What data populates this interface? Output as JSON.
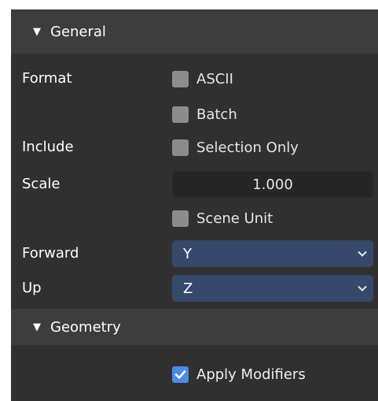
{
  "general": {
    "title": "General",
    "format_label": "Format",
    "ascii_label": "ASCII",
    "ascii_checked": false,
    "batch_label": "Batch",
    "batch_checked": false,
    "include_label": "Include",
    "selection_only_label": "Selection Only",
    "selection_only_checked": false,
    "scale_label": "Scale",
    "scale_value": "1.000",
    "scene_unit_label": "Scene Unit",
    "scene_unit_checked": false,
    "forward_label": "Forward",
    "forward_value": "Y",
    "up_label": "Up",
    "up_value": "Z"
  },
  "geometry": {
    "title": "Geometry",
    "apply_modifiers_label": "Apply Modifiers",
    "apply_modifiers_checked": true
  },
  "colors": {
    "panel_bg": "#303030",
    "header_bg": "#3d3d3d",
    "checkbox_off": "#8c8c8c",
    "checkbox_on": "#4d8be6",
    "select_bg": "#37496a",
    "number_field_bg": "#262626"
  },
  "icons": {
    "expand": "triangle-down-icon",
    "dropdown": "chevron-down-icon",
    "check": "checkmark-icon"
  }
}
